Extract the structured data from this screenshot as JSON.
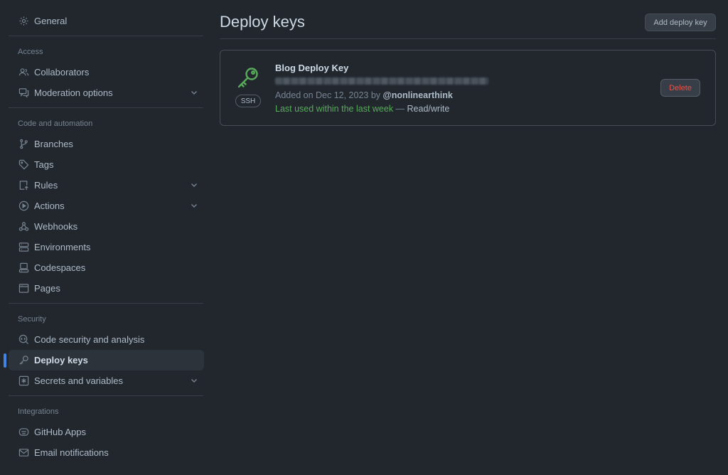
{
  "sidebar": {
    "general": "General",
    "access_head": "Access",
    "collaborators": "Collaborators",
    "moderation": "Moderation options",
    "code_head": "Code and automation",
    "branches": "Branches",
    "tags": "Tags",
    "rules": "Rules",
    "actions": "Actions",
    "webhooks": "Webhooks",
    "environments": "Environments",
    "codespaces": "Codespaces",
    "pages": "Pages",
    "security_head": "Security",
    "code_security": "Code security and analysis",
    "deploy_keys": "Deploy keys",
    "secrets": "Secrets and variables",
    "integrations_head": "Integrations",
    "github_apps": "GitHub Apps",
    "email_notifications": "Email notifications"
  },
  "main": {
    "title": "Deploy keys",
    "add_button": "Add deploy key",
    "key": {
      "badge": "SSH",
      "name": "Blog Deploy Key",
      "added_prefix": "Added on Dec 12, 2023 by",
      "added_by": "@nonlinearthink",
      "last_used": "Last used within the last week",
      "separator": " — ",
      "access": "Read/write",
      "delete_button": "Delete"
    }
  },
  "colors": {
    "background": "#22272e",
    "accent": "#4184e4",
    "success": "#57ab5a",
    "danger": "#e5534b"
  }
}
